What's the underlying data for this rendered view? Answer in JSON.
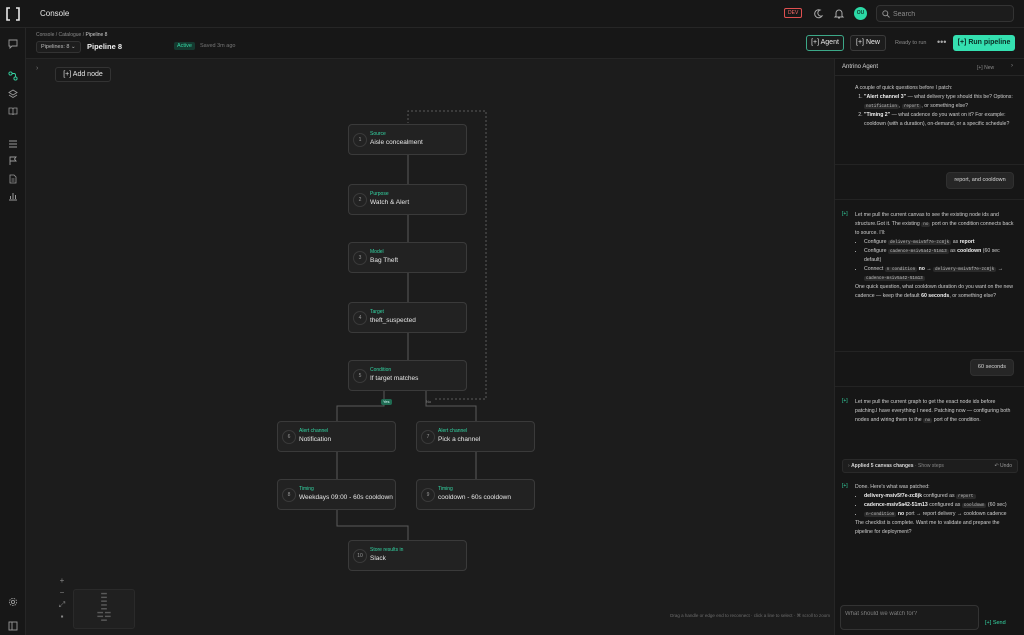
{
  "app": {
    "title": "Console",
    "env_badge": "DEV",
    "avatar_initials": "OU",
    "search_placeholder": "Search"
  },
  "subheader": {
    "breadcrumb": [
      "Console",
      "Catalogue",
      "Pipeline 8"
    ],
    "pipelines_select": "Pipelines: 8",
    "pipeline_title": "Pipeline 8",
    "status": "Active",
    "saved": "Saved 3m ago",
    "agent_button": "Agent",
    "new_button": "New",
    "ready_text": "Ready to run",
    "more": "•••",
    "run_button": "Run pipeline"
  },
  "canvas": {
    "add_node": "Add node",
    "nodes": [
      {
        "num": "1",
        "type": "Source",
        "label": "Aisle concealment"
      },
      {
        "num": "2",
        "type": "Purpose",
        "label": "Watch & Alert"
      },
      {
        "num": "3",
        "type": "Model",
        "label": "Bag Theft"
      },
      {
        "num": "4",
        "type": "Target",
        "label": "theft_suspected"
      },
      {
        "num": "5",
        "type": "Condition",
        "label": "If target matches"
      },
      {
        "num": "6",
        "type": "Alert channel",
        "label": "Notification"
      },
      {
        "num": "7",
        "type": "Alert channel",
        "label": "Pick a channel"
      },
      {
        "num": "8",
        "type": "Timing",
        "label": "Weekdays 09:00 - 60s cooldown"
      },
      {
        "num": "9",
        "type": "Timing",
        "label": "cooldown - 60s cooldown"
      },
      {
        "num": "10",
        "type": "Store results in",
        "label": "Slack"
      }
    ],
    "edge_yes": "Yes",
    "edge_no": "No",
    "hint": "Drag a handle or edge end to reconnect · click a line to select · ⌘ scroll to zoom"
  },
  "agent": {
    "title": "Antrino Agent",
    "new_link": "New",
    "intro": "A couple of quick questions before I patch:",
    "q1_bold": "\"Alert channel 3\"",
    "q1_text": "— what delivery type should this be? Options:",
    "q1_opt1": "notification",
    "q1_opt2": "report",
    "q1_tail": ", or something else?",
    "q2_bold": "\"Timing 2\"",
    "q2_text": "— what cadence do you want on it? For example: cooldown (with a duration), on-demand, or a specific schedule?",
    "user1": "report, and cooldown",
    "m2_intro": "Let me pull the current canvas to see the existing node ids and structure.Got it. The existing",
    "m2_chip_no": "no",
    "m2_intro2": "port on the condition connects back to source. I'll:",
    "m2_b1_pre": "Configure",
    "m2_b1_chip": "delivery-msiv5f7e-zc8jk",
    "m2_b1_post": "as",
    "m2_b1_bold": "report",
    "m2_b2_pre": "Configure",
    "m2_b2_chip": "cadence-msiv5a42-51m13",
    "m2_b2_post": "as",
    "m2_b2_bold": "cooldown",
    "m2_b2_tail": "(60 sec default)",
    "m2_b3_pre": "Connect",
    "m2_b3_chip1": "n condition",
    "m2_b3_bold": "no",
    "m2_b3_chip2": "delivery-msiv5f7e-zc8jk",
    "m2_b3_chip3": "cadence-msiv5a42-51m13",
    "m2_question": "One quick question, what cooldown duration do you want on the new cadence — keep the default",
    "m2_question_bold": "60 seconds",
    "m2_question_tail": ", or something else?",
    "user2": "60 seconds",
    "m3_text": "Let me pull the current graph to get the exact node ids before patching.I have everything I need. Patching now — configuring both nodes and wiring them to the",
    "m3_chip": "no",
    "m3_tail": "port of the condition.",
    "applied_label": "Applied 5 canvas changes",
    "applied_steps": "· Show steps",
    "applied_undo": "Undo",
    "m4_intro": "Done. Here's what was patched:",
    "m4_b1_bold": "delivery-msiv5f7e-zc8jk",
    "m4_b1_text": "configured as",
    "m4_b1_chip": "report",
    "m4_b2_bold": "cadence-msiv5a42-51m13",
    "m4_b2_text": "configured as",
    "m4_b2_chip": "cooldown",
    "m4_b2_tail": "(60 sec)",
    "m4_b3_chip": "n-condition",
    "m4_b3_bold": "no",
    "m4_b3_text": "port → report delivery → cooldown cadence",
    "m4_outro": "The checklist is complete. Want me to validate and prepare the pipeline for deployment?",
    "composer_placeholder": "What should we watch for?",
    "send": "Send"
  },
  "colors": {
    "accent": "#34e0b0",
    "background": "#141414",
    "node": "#222222",
    "danger": "#e05050"
  },
  "icons": [
    "logo-icon",
    "moon-icon",
    "bell-icon",
    "search-icon",
    "chat-icon",
    "pipeline-icon",
    "layers-icon",
    "book-icon",
    "list-icon",
    "flag-icon",
    "document-icon",
    "chart-icon",
    "settings-icon",
    "panel-icon"
  ]
}
